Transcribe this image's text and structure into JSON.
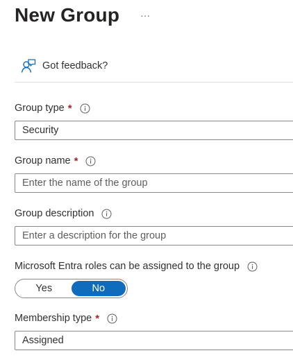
{
  "header": {
    "title": "New Group",
    "more_label": "···"
  },
  "feedback": {
    "icon": "feedback-person-icon",
    "label": "Got feedback?"
  },
  "colors": {
    "required": "#a4262c",
    "accent": "#0f6cbd",
    "border": "#8a8886"
  },
  "form": {
    "group_type": {
      "label": "Group type",
      "required_mark": "*",
      "value": "Security"
    },
    "group_name": {
      "label": "Group name",
      "required_mark": "*",
      "placeholder": "Enter the name of the group"
    },
    "group_description": {
      "label": "Group description",
      "placeholder": "Enter a description for the group"
    },
    "entra_roles": {
      "label": "Microsoft Entra roles can be assigned to the group",
      "options": [
        "Yes",
        "No"
      ],
      "selected": "No"
    },
    "membership_type": {
      "label": "Membership type",
      "required_mark": "*",
      "value": "Assigned"
    }
  }
}
